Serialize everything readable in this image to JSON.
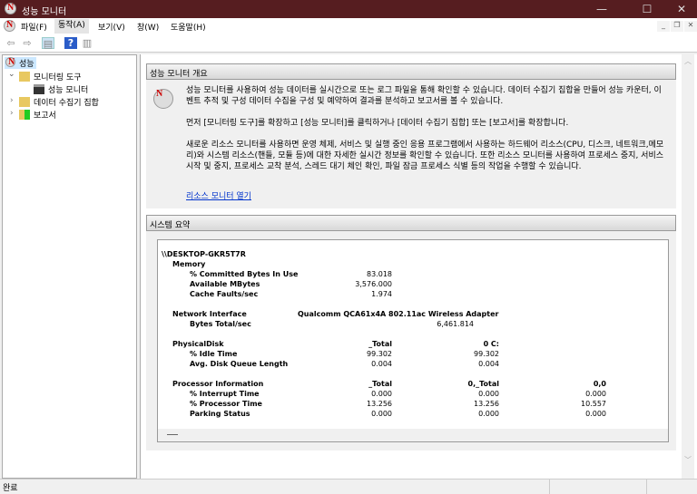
{
  "window": {
    "title": "성능 모니터",
    "minimize": "—",
    "maximize": "☐",
    "close": "✕"
  },
  "menu": [
    "파일(F)",
    "동작(A)",
    "보기(V)",
    "창(W)",
    "도움말(H)"
  ],
  "mdi": {
    "min": "_",
    "restore": "❐",
    "close": "✕"
  },
  "toolbar": {
    "back": "⇦",
    "forward": "⇨",
    "help": "?"
  },
  "tree": {
    "root": "성능",
    "monitoring_tools": "모니터링 도구",
    "perf_monitor": "성능 모니터",
    "data_collector_sets": "데이터 수집기 집합",
    "reports": "보고서"
  },
  "overview": {
    "header": "성능 모니터 개요",
    "p1": "성능 모니터를 사용하여 성능 데이터를 실시간으로 또는 로그 파일을 통해 확인할 수 있습니다. 데이터 수집기 집합을 만들어 성능 카운터, 이벤트 추적 및 구성 데이터 수집을 구성 및 예약하여 결과를 분석하고 보고서를 볼 수 있습니다.",
    "p2": "먼저 [모니터링 도구]를 확장하고 [성능 모니터]를 클릭하거나 [데이터 수집기 집합] 또는 [보고서]를 확장합니다.",
    "p3": "새로운 리소스 모니터를 사용하면 운영 체제, 서비스 및 실행 중인 응용 프로그램에서 사용하는 하드웨어 리소스(CPU, 디스크, 네트워크,메모리)와 시스템 리소스(핸들, 모듈 등)에 대한 자세한 실시간 정보를 확인할 수 있습니다. 또한 리소스 모니터를 사용하여 프로세스 중지, 서비스 시작 및 중지, 프로세스 교착 분석, 스레드 대기 체인 확인, 파일 잠금 프로세스 식별 등의 작업을 수행할 수 있습니다.",
    "link": "리소스 모니터 열기"
  },
  "summary": {
    "header": "시스템 요약",
    "host": "\\\\DESKTOP-GKR5T7R",
    "memory": {
      "title": "Memory",
      "rows": [
        [
          "% Committed Bytes In Use",
          "83.018"
        ],
        [
          "Available MBytes",
          "3,576.000"
        ],
        [
          "Cache Faults/sec",
          "1.974"
        ]
      ]
    },
    "network": {
      "title": "Network Interface",
      "adapter": "Qualcomm QCA61x4A 802.11ac Wireless Adapter",
      "rows": [
        [
          "Bytes Total/sec",
          "6,461.814"
        ]
      ]
    },
    "disk": {
      "title": "PhysicalDisk",
      "cols": [
        "_Total",
        "0 C:"
      ],
      "rows": [
        [
          "% Idle Time",
          "99.302",
          "99.302"
        ],
        [
          "Avg. Disk Queue Length",
          "0.004",
          "0.004"
        ]
      ]
    },
    "cpu": {
      "title": "Processor Information",
      "cols": [
        "_Total",
        "0,_Total",
        "0,0"
      ],
      "rows": [
        [
          "% Interrupt Time",
          "0.000",
          "0.000",
          "0.000"
        ],
        [
          "% Processor Time",
          "13.256",
          "13.256",
          "10.557"
        ],
        [
          "Parking Status",
          "0.000",
          "0.000",
          "0.000"
        ]
      ]
    }
  },
  "status": "완료"
}
